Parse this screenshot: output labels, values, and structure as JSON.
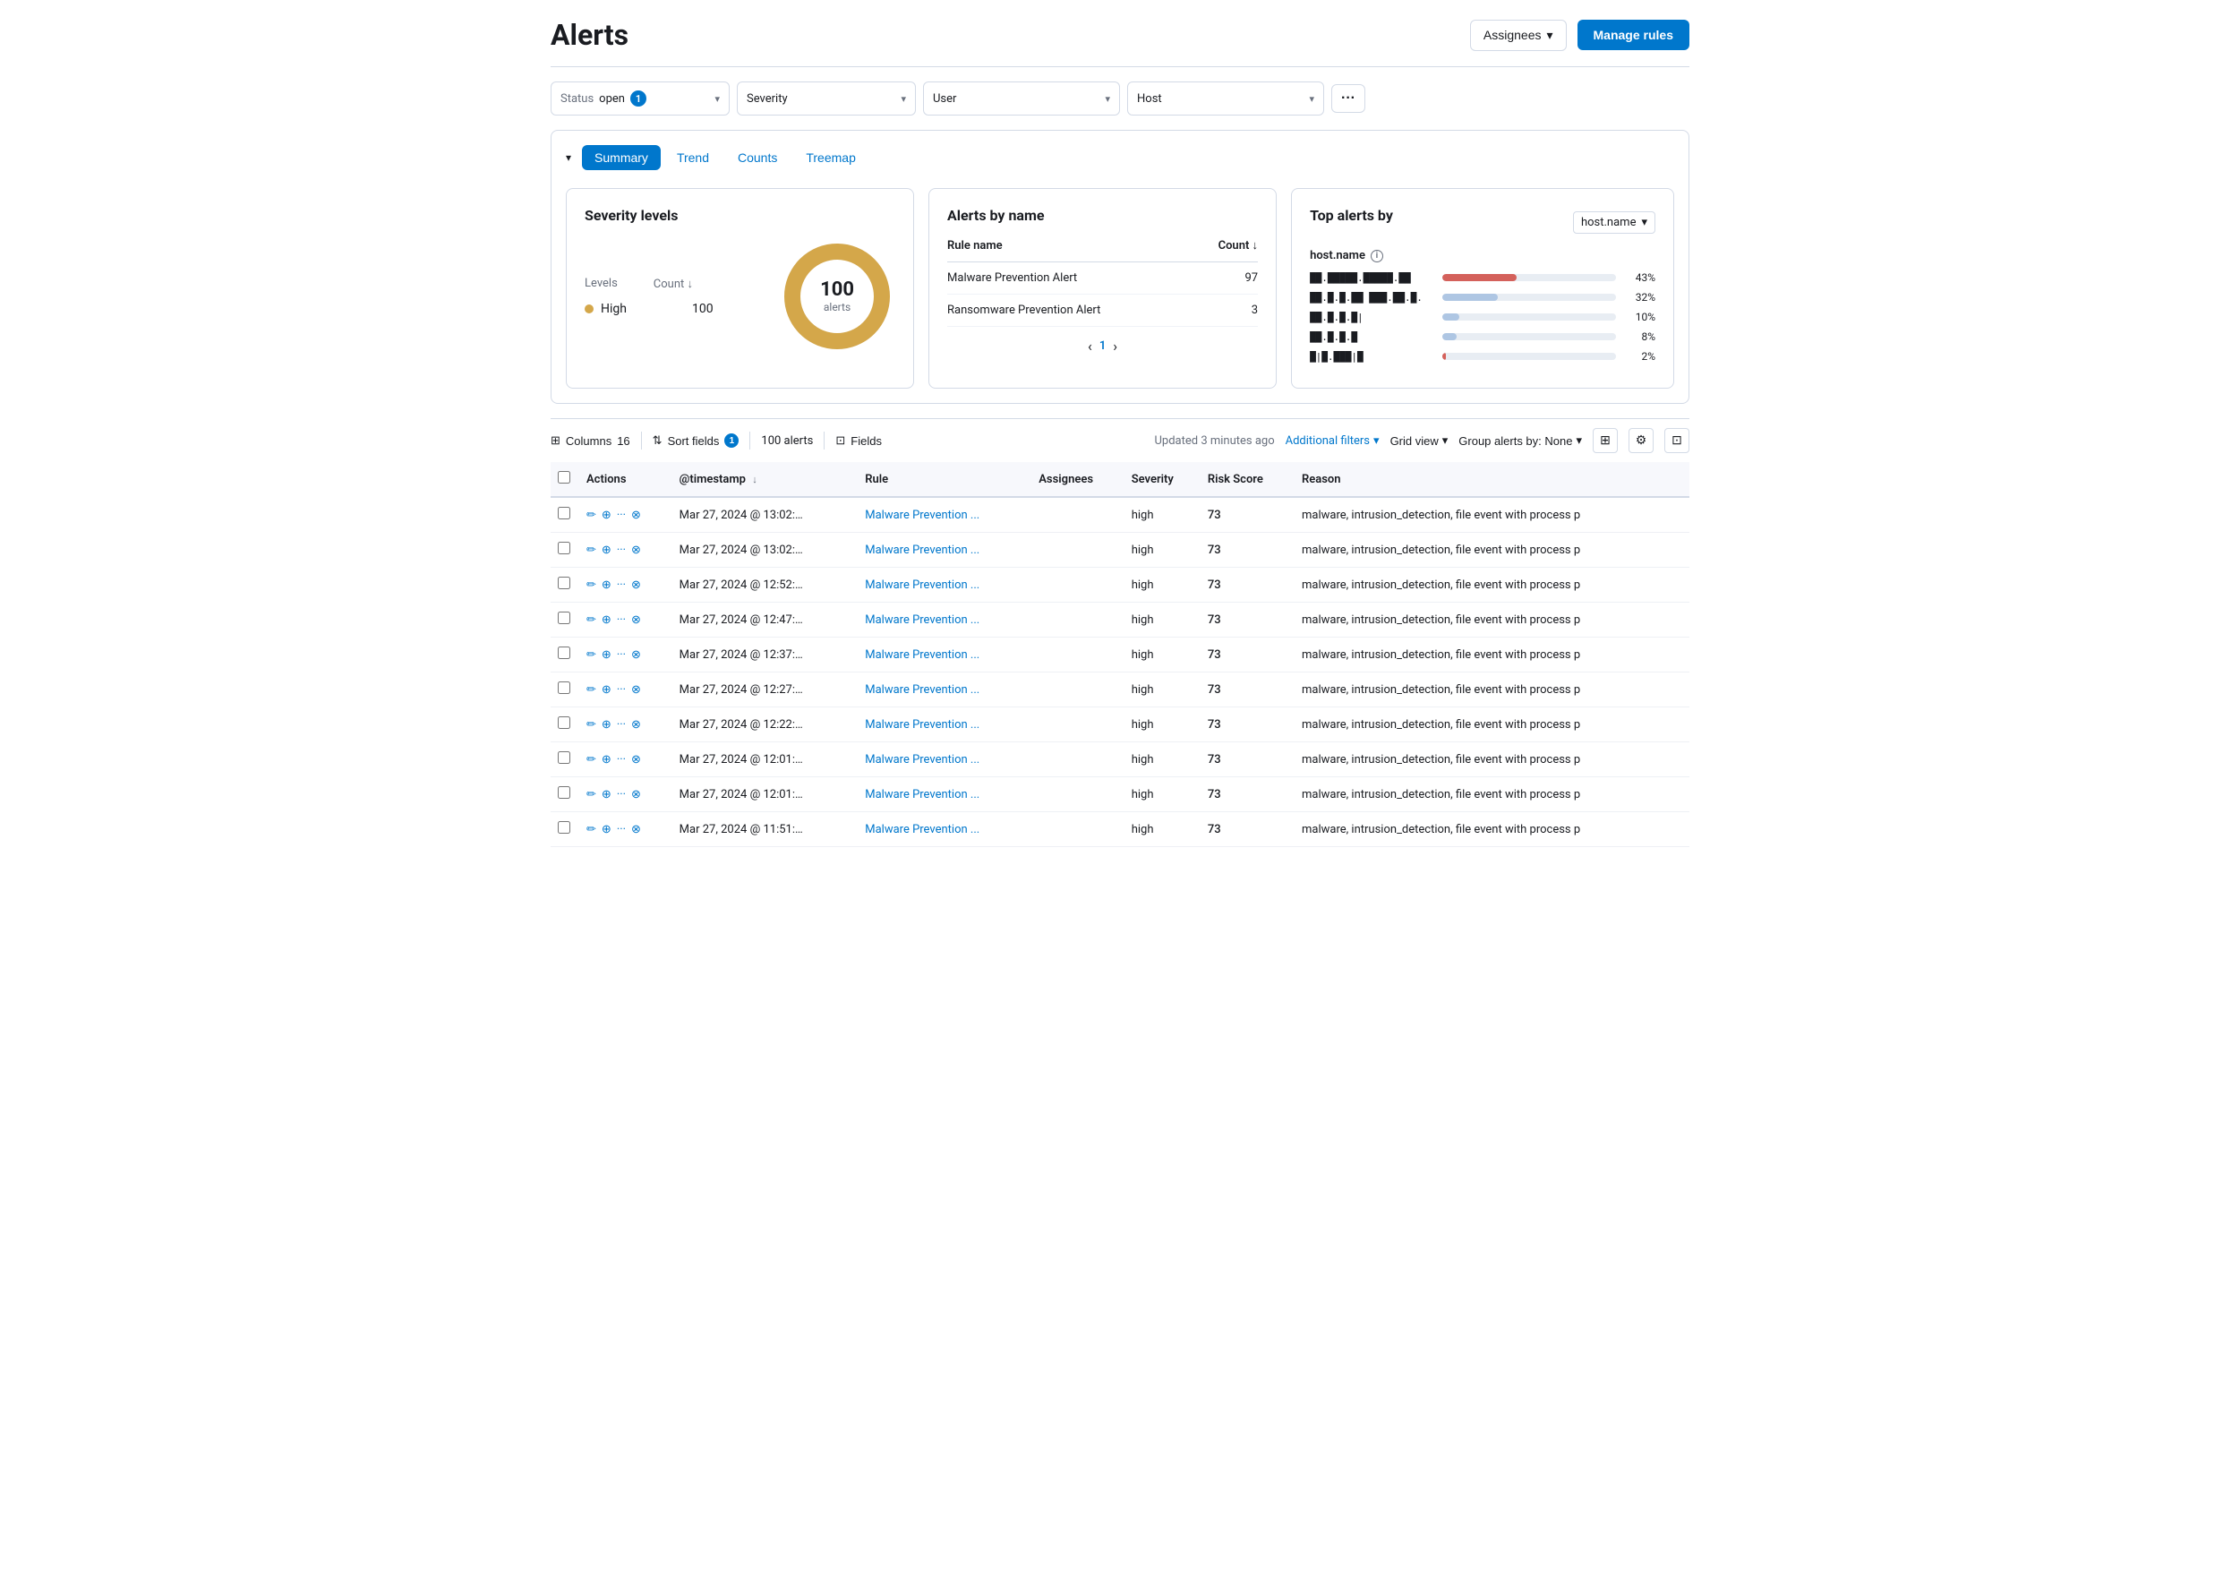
{
  "page": {
    "title": "Alerts"
  },
  "header": {
    "assignees_label": "Assignees",
    "manage_rules_label": "Manage rules"
  },
  "filters": {
    "status_label": "Status",
    "status_value": "open",
    "status_badge": "1",
    "severity_label": "Severity",
    "user_label": "User",
    "host_label": "Host",
    "more_label": "···"
  },
  "panel": {
    "toggle_icon": "▾",
    "tabs": [
      "Summary",
      "Trend",
      "Counts",
      "Treemap"
    ],
    "active_tab": "Summary"
  },
  "severity_card": {
    "title": "Severity levels",
    "levels_col": "Levels",
    "count_col": "Count",
    "rows": [
      {
        "level": "High",
        "color": "#d4a74a",
        "count": 100
      }
    ],
    "donut_total": "100",
    "donut_label": "alerts"
  },
  "alerts_by_name_card": {
    "title": "Alerts by name",
    "col_rule": "Rule name",
    "col_count": "Count",
    "rows": [
      {
        "rule": "Malware Prevention Alert",
        "count": 97
      },
      {
        "rule": "Ransomware Prevention Alert",
        "count": 3
      }
    ],
    "pagination": {
      "current": 1,
      "has_prev": false,
      "has_next": false
    }
  },
  "top_alerts_card": {
    "title": "Top alerts by",
    "select_value": "host.name",
    "subtitle": "host.name",
    "bars": [
      {
        "label": "██.█████.█████.██",
        "pct": 43,
        "width_pct": 43,
        "color": "accent"
      },
      {
        "label": "██.█.█.██ ███.██.█.",
        "pct": 32,
        "width_pct": 32,
        "color": "blue"
      },
      {
        "label": "██.█.█.█|",
        "pct": 10,
        "width_pct": 10,
        "color": "blue"
      },
      {
        "label": "██.█.█.█",
        "pct": 8,
        "width_pct": 8,
        "color": "blue"
      },
      {
        "label": "█|█.███|█",
        "pct": 2,
        "width_pct": 2,
        "color": "accent"
      }
    ]
  },
  "table_toolbar": {
    "columns_label": "Columns",
    "columns_count": "16",
    "sort_label": "Sort fields",
    "sort_count": "1",
    "alerts_count": "100 alerts",
    "fields_label": "Fields",
    "updated_text": "Updated 3 minutes ago",
    "filters_label": "Additional filters",
    "view_label": "Grid view",
    "group_label": "Group alerts by: None",
    "icon_table": "⊞",
    "icon_settings": "⚙",
    "icon_expand": "⊡"
  },
  "table": {
    "headers": [
      "Actions",
      "@timestamp",
      "Rule",
      "Assignees",
      "Severity",
      "Risk Score",
      "Reason"
    ],
    "rows": [
      {
        "timestamp": "Mar 27, 2024 @ 13:02:…",
        "rule": "Malware Prevention ...",
        "assignees": "",
        "severity": "high",
        "risk_score": 73,
        "reason": "malware, intrusion_detection, file event with process p"
      },
      {
        "timestamp": "Mar 27, 2024 @ 13:02:…",
        "rule": "Malware Prevention ...",
        "assignees": "",
        "severity": "high",
        "risk_score": 73,
        "reason": "malware, intrusion_detection, file event with process p"
      },
      {
        "timestamp": "Mar 27, 2024 @ 12:52:…",
        "rule": "Malware Prevention ...",
        "assignees": "",
        "severity": "high",
        "risk_score": 73,
        "reason": "malware, intrusion_detection, file event with process p"
      },
      {
        "timestamp": "Mar 27, 2024 @ 12:47:…",
        "rule": "Malware Prevention ...",
        "assignees": "",
        "severity": "high",
        "risk_score": 73,
        "reason": "malware, intrusion_detection, file event with process p"
      },
      {
        "timestamp": "Mar 27, 2024 @ 12:37:…",
        "rule": "Malware Prevention ...",
        "assignees": "",
        "severity": "high",
        "risk_score": 73,
        "reason": "malware, intrusion_detection, file event with process p"
      },
      {
        "timestamp": "Mar 27, 2024 @ 12:27:…",
        "rule": "Malware Prevention ...",
        "assignees": "",
        "severity": "high",
        "risk_score": 73,
        "reason": "malware, intrusion_detection, file event with process p"
      },
      {
        "timestamp": "Mar 27, 2024 @ 12:22:…",
        "rule": "Malware Prevention ...",
        "assignees": "",
        "severity": "high",
        "risk_score": 73,
        "reason": "malware, intrusion_detection, file event with process p"
      },
      {
        "timestamp": "Mar 27, 2024 @ 12:01:…",
        "rule": "Malware Prevention ...",
        "assignees": "",
        "severity": "high",
        "risk_score": 73,
        "reason": "malware, intrusion_detection, file event with process p"
      },
      {
        "timestamp": "Mar 27, 2024 @ 12:01:…",
        "rule": "Malware Prevention ...",
        "assignees": "",
        "severity": "high",
        "risk_score": 73,
        "reason": "malware, intrusion_detection, file event with process p"
      },
      {
        "timestamp": "Mar 27, 2024 @ 11:51:…",
        "rule": "Malware Prevention ...",
        "assignees": "",
        "severity": "high",
        "risk_score": 73,
        "reason": "malware, intrusion_detection, file event with process p"
      }
    ]
  }
}
